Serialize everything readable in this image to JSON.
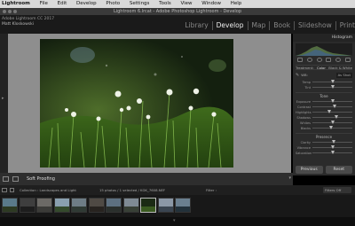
{
  "os_menu": {
    "app_name": "Lightroom",
    "items": [
      "File",
      "Edit",
      "Develop",
      "Photo",
      "Settings",
      "Tools",
      "View",
      "Window",
      "Help"
    ]
  },
  "window": {
    "title": "Lightroom 6.lrcat - Adobe Photoshop Lightroom - Develop"
  },
  "identity_plate": {
    "line1": "Adobe Lightroom CC 2017",
    "line2": "Matt Kloskowski"
  },
  "modules": [
    "Library",
    "Develop",
    "Map",
    "Book",
    "Slideshow",
    "Print"
  ],
  "active_module": "Develop",
  "right_panel": {
    "header": "Histogram",
    "tabs": [
      "Treatment:",
      "Color",
      "Black & White"
    ],
    "active_tab": "Color",
    "wb_label": "WB:",
    "wb_value": "As Shot",
    "sections": {
      "basic_tone": "Tone",
      "presence": "Presence"
    },
    "sliders_wb": [
      {
        "label": "Temp",
        "value": 0.5
      },
      {
        "label": "Tint",
        "value": 0.52
      }
    ],
    "sliders_tone": [
      {
        "label": "Exposure",
        "value": 0.5
      },
      {
        "label": "Contrast",
        "value": 0.55
      },
      {
        "label": "Highlights",
        "value": 0.42
      },
      {
        "label": "Shadows",
        "value": 0.6
      },
      {
        "label": "Whites",
        "value": 0.5
      },
      {
        "label": "Blacks",
        "value": 0.47
      }
    ],
    "sliders_presence": [
      {
        "label": "Clarity",
        "value": 0.53
      },
      {
        "label": "Vibrance",
        "value": 0.5
      },
      {
        "label": "Saturation",
        "value": 0.5
      }
    ],
    "buttons": {
      "previous": "Previous",
      "reset": "Reset"
    }
  },
  "toolbar": {
    "label": "Soft Proofing"
  },
  "filmstrip": {
    "collection": "Collection : Landscapes and Light",
    "count": "15 photos / 1 selected / KGK_7608.NEF",
    "filter_label": "Filter :",
    "filter_value": "Filters Off",
    "thumbs": [
      {
        "sky": "#5a7a8a",
        "ground": "#2d3a22"
      },
      {
        "sky": "#3e3e3e",
        "ground": "#1d1d1d"
      },
      {
        "sky": "#6c6a66",
        "ground": "#3b3b38"
      },
      {
        "sky": "#8aa0b0",
        "ground": "#344a2c"
      },
      {
        "sky": "#6e7d86",
        "ground": "#2f3a34"
      },
      {
        "sky": "#4f4a44",
        "ground": "#27231f"
      },
      {
        "sky": "#5d7080",
        "ground": "#2a2f2c"
      },
      {
        "sky": "#7f8a94",
        "ground": "#384036"
      },
      {
        "sky": "#1b2a14",
        "ground": "#3a5a20"
      },
      {
        "sky": "#8b98a6",
        "ground": "#3a4550"
      },
      {
        "sky": "#6a7f8f",
        "ground": "#22313a"
      }
    ],
    "active_index": 8
  },
  "colors": {
    "accent": "#eeeeee",
    "canvas": "#8e8e8e",
    "panel": "#2b2b2b"
  }
}
